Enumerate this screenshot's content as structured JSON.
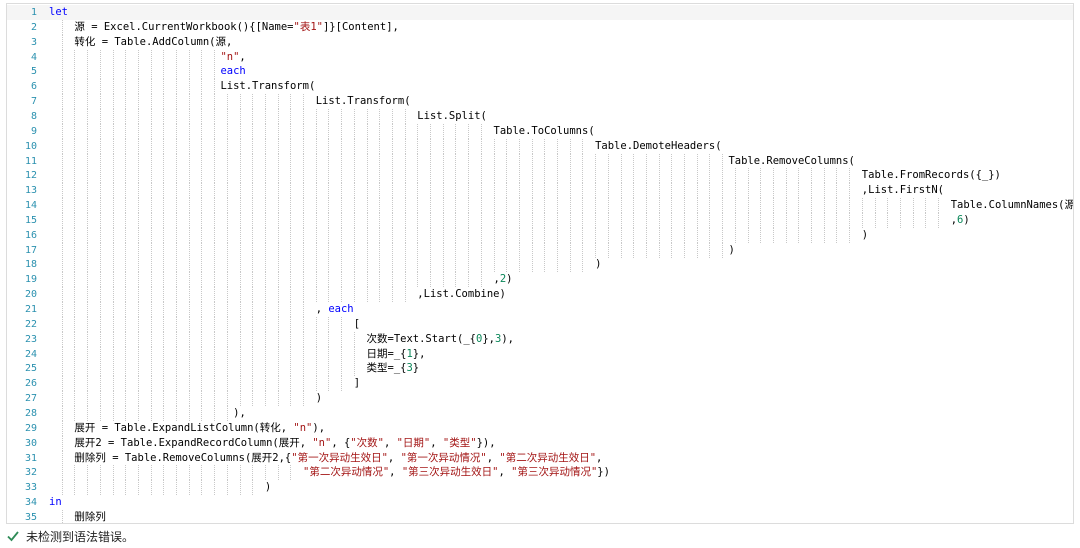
{
  "editor": {
    "lines": [
      {
        "n": "1",
        "text": "let",
        "indent": 0,
        "kw": true
      },
      {
        "n": "2",
        "text": "源 = Excel.CurrentWorkbook(){[Name=\"表1\"]}[Content],",
        "indent": 4
      },
      {
        "n": "3",
        "text": "转化 = Table.AddColumn(源,",
        "indent": 4
      },
      {
        "n": "4",
        "text": "\"n\",",
        "indent": 27
      },
      {
        "n": "5",
        "text": "each",
        "indent": 27,
        "kw": true
      },
      {
        "n": "6",
        "text": "List.Transform(",
        "indent": 27
      },
      {
        "n": "7",
        "text": "List.Transform(",
        "indent": 42
      },
      {
        "n": "8",
        "text": "List.Split(",
        "indent": 58
      },
      {
        "n": "9",
        "text": "Table.ToColumns(",
        "indent": 70
      },
      {
        "n": "10",
        "text": "Table.DemoteHeaders(",
        "indent": 86
      },
      {
        "n": "11",
        "text": "Table.RemoveColumns(",
        "indent": 107
      },
      {
        "n": "12",
        "text": "Table.FromRecords({_})",
        "indent": 128
      },
      {
        "n": "13",
        "text": ",List.FirstN(",
        "indent": 128
      },
      {
        "n": "14",
        "text": "Table.ColumnNames(源)",
        "indent": 142
      },
      {
        "n": "15",
        "text": ",6)",
        "indent": 142
      },
      {
        "n": "16",
        "text": ")",
        "indent": 128
      },
      {
        "n": "17",
        "text": ")",
        "indent": 107
      },
      {
        "n": "18",
        "text": ")",
        "indent": 86
      },
      {
        "n": "19",
        "text": ",2)",
        "indent": 70
      },
      {
        "n": "20",
        "text": ",List.Combine)",
        "indent": 58
      },
      {
        "n": "21",
        "text": ", each",
        "indent": 42
      },
      {
        "n": "22",
        "text": "[",
        "indent": 48
      },
      {
        "n": "23",
        "text": "次数=Text.Start(_{0},3),",
        "indent": 50
      },
      {
        "n": "24",
        "text": "日期=_{1},",
        "indent": 50
      },
      {
        "n": "25",
        "text": "类型=_{3}",
        "indent": 50
      },
      {
        "n": "26",
        "text": "]",
        "indent": 48
      },
      {
        "n": "27",
        "text": ")",
        "indent": 42
      },
      {
        "n": "28",
        "text": "),",
        "indent": 29
      },
      {
        "n": "29",
        "text": "展开 = Table.ExpandListColumn(转化, \"n\"),",
        "indent": 4
      },
      {
        "n": "30",
        "text": "展开2 = Table.ExpandRecordColumn(展开, \"n\", {\"次数\", \"日期\", \"类型\"}),",
        "indent": 4
      },
      {
        "n": "31",
        "text": "删除列 = Table.RemoveColumns(展开2,{\"第一次异动生效日\", \"第一次异动情况\", \"第二次异动生效日\",",
        "indent": 4
      },
      {
        "n": "32",
        "text": "\"第二次异动情况\", \"第三次异动生效日\", \"第三次异动情况\"})",
        "indent": 40
      },
      {
        "n": "33",
        "text": ")",
        "indent": 34
      },
      {
        "n": "34",
        "text": "in",
        "indent": 0,
        "kw": true
      },
      {
        "n": "35",
        "text": "删除列",
        "indent": 4
      }
    ]
  },
  "status": {
    "icon": "check-icon",
    "text": "未检测到语法错误。",
    "icon_color": "#2e8b57"
  }
}
